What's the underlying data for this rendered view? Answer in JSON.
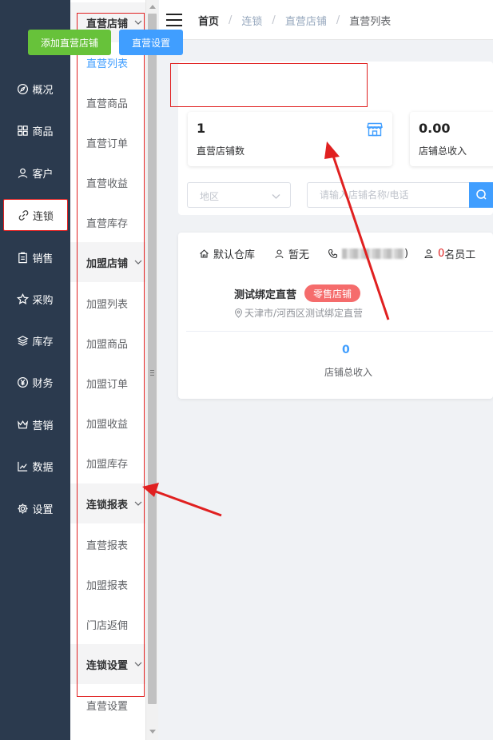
{
  "nav": {
    "items": [
      {
        "label": "概况",
        "icon": "compass-icon"
      },
      {
        "label": "商品",
        "icon": "grid-icon"
      },
      {
        "label": "客户",
        "icon": "user-icon"
      },
      {
        "label": "连锁",
        "icon": "link-icon"
      },
      {
        "label": "销售",
        "icon": "clipboard-icon"
      },
      {
        "label": "采购",
        "icon": "badge-icon"
      },
      {
        "label": "库存",
        "icon": "layers-icon"
      },
      {
        "label": "财务",
        "icon": "yen-icon"
      },
      {
        "label": "营销",
        "icon": "crown-icon"
      },
      {
        "label": "数据",
        "icon": "chart-icon"
      },
      {
        "label": "设置",
        "icon": "gear-icon"
      }
    ],
    "active": "连锁"
  },
  "submenu": {
    "groups": [
      {
        "label": "直营店铺",
        "items": [
          "直营列表",
          "直营商品",
          "直营订单",
          "直营收益",
          "直营库存"
        ]
      },
      {
        "label": "加盟店铺",
        "items": [
          "加盟列表",
          "加盟商品",
          "加盟订单",
          "加盟收益",
          "加盟库存"
        ]
      },
      {
        "label": "连锁报表",
        "items": [
          "直营报表",
          "加盟报表",
          "门店返佣"
        ]
      },
      {
        "label": "连锁设置",
        "items": [
          "直营设置"
        ]
      }
    ],
    "active": "直营列表"
  },
  "header": {
    "breadcrumb": [
      "首页",
      "连锁",
      "直营店铺",
      "直营列表"
    ]
  },
  "toolbar": {
    "add_label": "添加直营店铺",
    "settings_label": "直营设置"
  },
  "stats": [
    {
      "value": "1",
      "label": "直营店铺数"
    },
    {
      "value": "0.00",
      "label": "店铺总收入"
    }
  ],
  "filters": {
    "region_placeholder": "地区",
    "search_placeholder": "请输入店铺名称/电话"
  },
  "store": {
    "warehouse": "默认仓库",
    "contact": "暂无",
    "phone_suffix": ")",
    "staff_count": "0",
    "staff_suffix": "名员工",
    "name": "测试绑定直营",
    "tag": "零售店铺",
    "address": "天津市/河西区测试绑定直营",
    "income_value": "0",
    "income_label": "店铺总收入"
  },
  "colors": {
    "nav_bg": "#2b3a4e",
    "primary": "#409eff",
    "success": "#67c23a",
    "danger": "#f56c6c",
    "annotation": "#e02020"
  }
}
